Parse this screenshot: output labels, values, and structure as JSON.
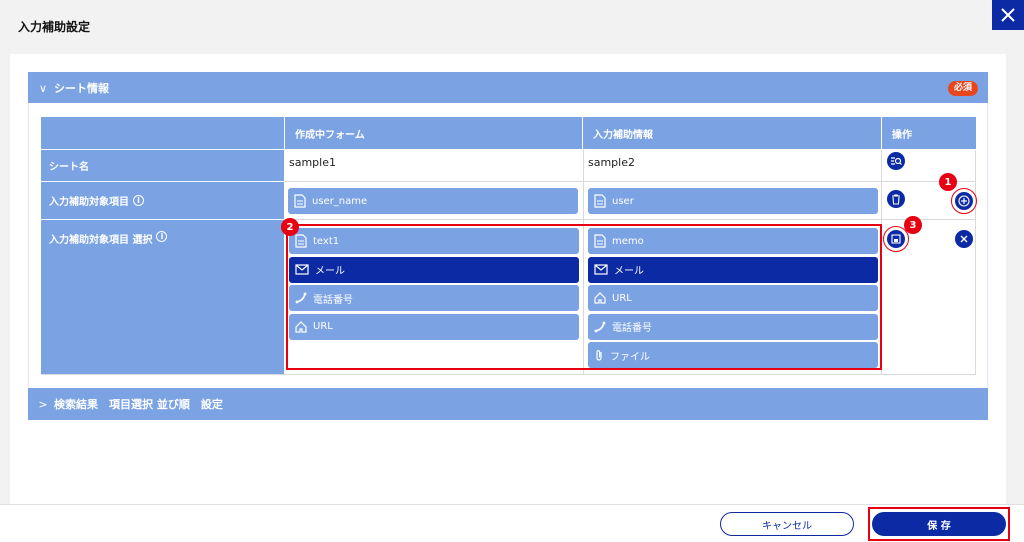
{
  "dialog": {
    "title": "入力補助設定"
  },
  "sheet_section": {
    "title": "シート情報",
    "required_badge": "必須",
    "headers": {
      "form": "作成中フォーム",
      "assist": "入力補助情報",
      "ops": "操作"
    },
    "rows": {
      "sheet_name": {
        "label": "シート名",
        "form_value": "sample1",
        "assist_value": "sample2"
      },
      "target_item": {
        "label": "入力補助対象項目",
        "form_item": "user_name",
        "assist_item": "user"
      },
      "target_select": {
        "label": "入力補助対象項目 選択",
        "form_items": [
          {
            "label": "text1",
            "icon": "document-icon",
            "selected": false
          },
          {
            "label": "メール",
            "icon": "mail-icon",
            "selected": true
          },
          {
            "label": "電話番号",
            "icon": "phone-icon",
            "selected": false
          },
          {
            "label": "URL",
            "icon": "home-icon",
            "selected": false
          }
        ],
        "assist_items": [
          {
            "label": "memo",
            "icon": "document-icon",
            "selected": false
          },
          {
            "label": "メール",
            "icon": "mail-icon",
            "selected": true
          },
          {
            "label": "URL",
            "icon": "home-icon",
            "selected": false
          },
          {
            "label": "電話番号",
            "icon": "phone-icon",
            "selected": false
          },
          {
            "label": "ファイル",
            "icon": "paperclip-icon",
            "selected": false
          }
        ]
      }
    }
  },
  "search_section": {
    "title": "検索結果　項目選択 並び順　設定"
  },
  "annotations": {
    "n1": "1",
    "n2": "2",
    "n3": "3"
  },
  "footer": {
    "cancel": "キャンセル",
    "save": "保 存"
  },
  "colors": {
    "primary": "#0c2aa4",
    "header": "#7ba3e4",
    "highlight": "#e60012"
  }
}
